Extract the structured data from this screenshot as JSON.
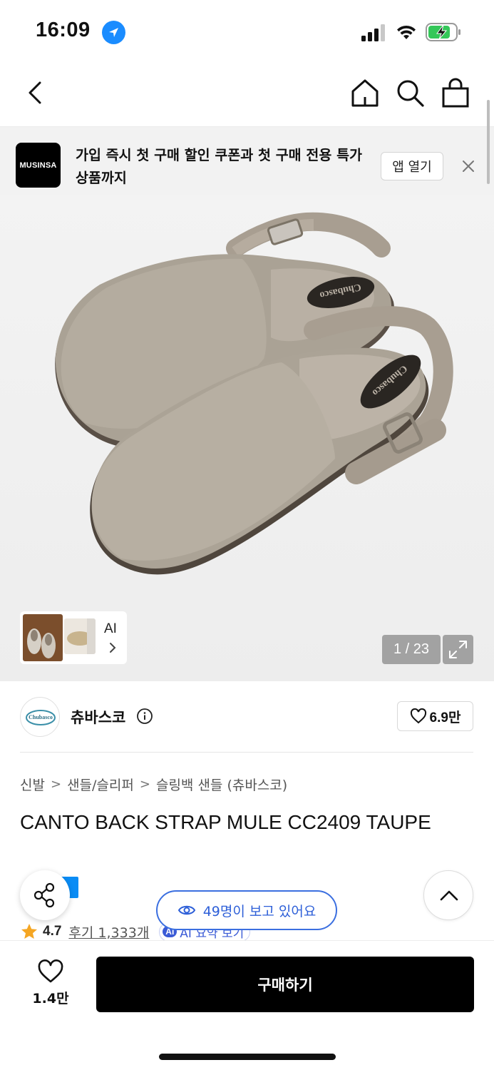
{
  "status_bar": {
    "time": "16:09"
  },
  "banner": {
    "logo_text": "MUSINSA",
    "message": "가입 즉시 첫 구매 할인 쿠폰과 첫 구매 전용 특가 상품까지",
    "open_app_label": "앱 열기"
  },
  "gallery": {
    "ai_label": "AI",
    "counter": "1 / 23",
    "image_brand_text": "Chubasco"
  },
  "brand": {
    "name": "츄바스코",
    "likes": "6.9만",
    "logo_text": "Chubasco"
  },
  "breadcrumb": [
    "신발",
    "샌들/슬리퍼",
    "슬링백 샌들 (츄바스코)"
  ],
  "breadcrumb_separator": ">",
  "product": {
    "title": "CANTO BACK STRAP MULE CC2409 TAUPE",
    "rating": "4.7",
    "reviews": "후기 1,333개",
    "ai_summary_badge": "AI",
    "ai_summary_label": "AI 요약 보기"
  },
  "viewers": {
    "text": "49명이 보고 있어요"
  },
  "bottom": {
    "wish_count": "1.4만",
    "buy_label": "구매하기"
  },
  "colors": {
    "accent_blue": "#3b6fe0",
    "badge_blue": "#0a8cf5",
    "buy_button": "#000000",
    "rating_star": "#f5a623"
  },
  "icons": [
    "location-icon",
    "signal-icon",
    "wifi-icon",
    "battery-icon",
    "back-icon",
    "home-icon",
    "search-icon",
    "shopping-bag-icon",
    "close-icon",
    "chevron-right-icon",
    "expand-icon",
    "info-icon",
    "heart-icon",
    "star-icon",
    "eye-icon",
    "share-icon",
    "chevron-up-icon"
  ]
}
